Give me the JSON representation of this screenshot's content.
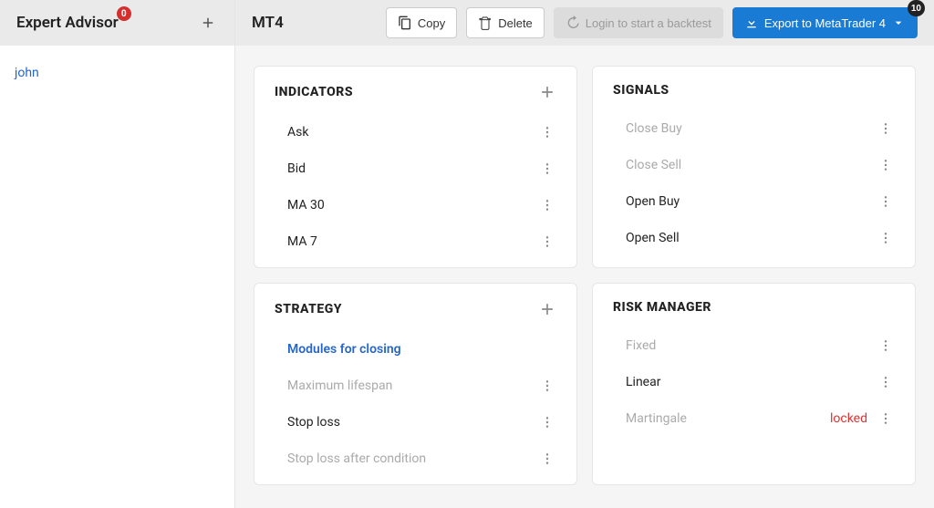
{
  "sidebar": {
    "title": "Expert Advisor",
    "badge": "0",
    "items": [
      {
        "label": "john"
      }
    ]
  },
  "topbar": {
    "title": "MT4",
    "copy": "Copy",
    "delete": "Delete",
    "backtest": "Login to start a backtest",
    "export": "Export to MetaTrader 4",
    "export_badge": "10"
  },
  "cards": {
    "indicators": {
      "title": "INDICATORS",
      "items": [
        {
          "label": "Ask"
        },
        {
          "label": "Bid"
        },
        {
          "label": "MA 30"
        },
        {
          "label": "MA 7"
        }
      ]
    },
    "signals": {
      "title": "SIGNALS",
      "items": [
        {
          "label": "Close Buy",
          "muted": true
        },
        {
          "label": "Close Sell",
          "muted": true
        },
        {
          "label": "Open Buy"
        },
        {
          "label": "Open Sell"
        }
      ]
    },
    "strategy": {
      "title": "STRATEGY",
      "section_label": "Modules for closing",
      "items": [
        {
          "label": "Maximum lifespan",
          "muted": true
        },
        {
          "label": "Stop loss"
        },
        {
          "label": "Stop loss after condition",
          "muted": true
        }
      ]
    },
    "risk": {
      "title": "RISK MANAGER",
      "locked_label": "locked",
      "items": [
        {
          "label": "Fixed",
          "muted": true
        },
        {
          "label": "Linear"
        },
        {
          "label": "Martingale",
          "muted": true,
          "locked": true
        }
      ]
    }
  }
}
